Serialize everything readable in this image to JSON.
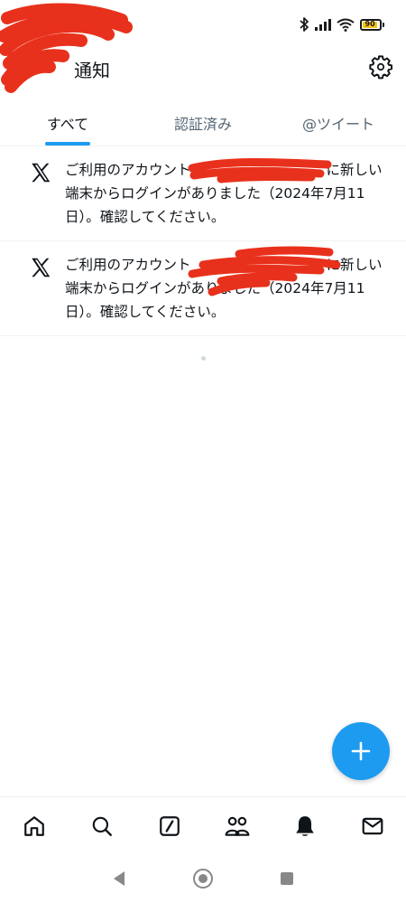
{
  "status_bar": {
    "battery_level": "90",
    "icons": [
      "bluetooth-icon",
      "signal-icon",
      "wifi-icon",
      "battery-icon"
    ]
  },
  "header": {
    "title": "通知",
    "settings_icon": "gear-icon"
  },
  "tabs": [
    {
      "label": "すべて",
      "active": true
    },
    {
      "label": "認証済み",
      "active": false
    },
    {
      "label": "@ツイート",
      "active": false
    }
  ],
  "notifications": [
    {
      "icon": "x-logo-icon",
      "text_before": "ご利用のアカウント",
      "text_after": "に新しい端末からログインがありました（2024年7月11日）。確認してください。"
    },
    {
      "icon": "x-logo-icon",
      "text_before": "ご利用のアカウント",
      "text_after": "に新しい端末からログインがありました（2024年7月11日）。確認してください。"
    }
  ],
  "fab": {
    "icon": "plus-icon"
  },
  "bottom_nav": [
    {
      "name": "home",
      "icon": "home-icon"
    },
    {
      "name": "search",
      "icon": "search-icon"
    },
    {
      "name": "grok",
      "icon": "grok-icon"
    },
    {
      "name": "communities",
      "icon": "people-icon"
    },
    {
      "name": "notifications",
      "icon": "bell-icon"
    },
    {
      "name": "messages",
      "icon": "mail-icon"
    }
  ],
  "colors": {
    "accent": "#1d9bf0",
    "text": "#0f1419",
    "muted": "#536471",
    "divider": "#eff3f4",
    "redaction": "#e8311c"
  }
}
